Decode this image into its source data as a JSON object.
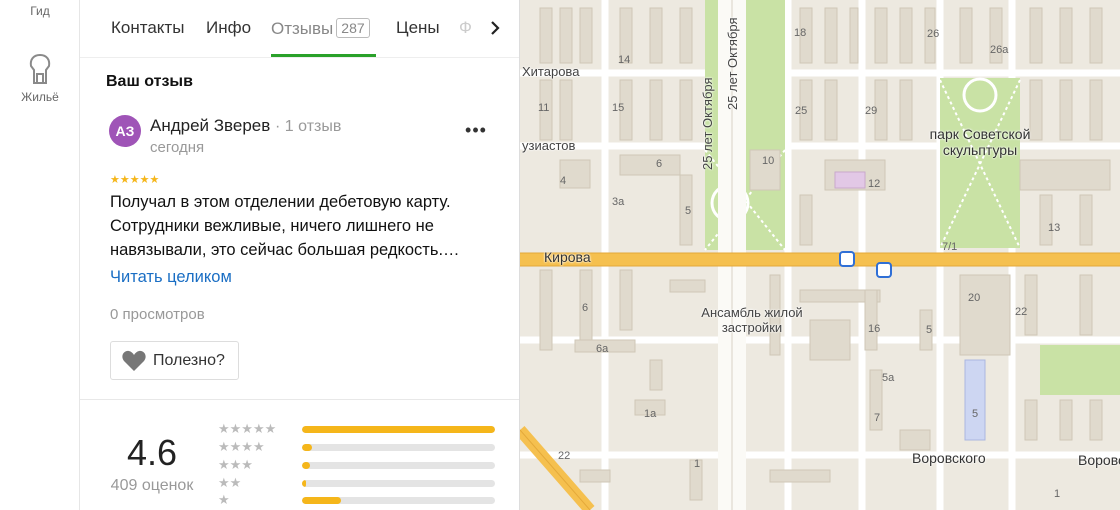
{
  "rail": {
    "top_label": "Гид",
    "housing_label": "Жильё"
  },
  "tabs": [
    {
      "label": "Контакты"
    },
    {
      "label": "Инфо"
    },
    {
      "label": "Отзывы",
      "count": "287"
    },
    {
      "label": "Цены"
    }
  ],
  "tab_faded": "Ф",
  "section_title": "Ваш отзыв",
  "review": {
    "avatar_initials": "АЗ",
    "author": "Андрей Зверев",
    "author_reviews": "1 отзыв",
    "date": "сегодня",
    "stars": "★★★★★",
    "text": "Получал в этом отделении дебетовую карту. Сотрудники вежливые, ничего лишнего не навязывали, это сейчас большая редкость.…",
    "read_more": "Читать целиком",
    "views": "0 просмотров",
    "useful_label": "Полезно?"
  },
  "rating": {
    "value": "4.6",
    "count": "409 оценок",
    "distribution": [
      {
        "stars": "★★★★★",
        "fraction": 1.0
      },
      {
        "stars": "★★★★",
        "fraction": 0.05
      },
      {
        "stars": "★★★",
        "fraction": 0.04
      },
      {
        "stars": "★★",
        "fraction": 0.02
      },
      {
        "stars": "★",
        "fraction": 0.2
      }
    ]
  },
  "map": {
    "streets": [
      "Хитарова",
      "узиастов",
      "Кирова",
      "Воровского",
      "Воровс"
    ],
    "vertical_streets": [
      "25 лет Октября",
      "25 лет Октября"
    ],
    "park": "парк Советской скульптуры",
    "landmark": "Ансамбль жилой застройки",
    "house_numbers": [
      "14",
      "18",
      "26",
      "26а",
      "11",
      "15",
      "25",
      "29",
      "6",
      "10",
      "12",
      "4",
      "3а",
      "5",
      "13",
      "7/1",
      "6",
      "20",
      "22",
      "16",
      "5",
      "5а",
      "6а",
      "7",
      "1а",
      "22",
      "1",
      "5",
      "1"
    ],
    "colors": {
      "road_main": "#f5c04f",
      "park": "#c9e2a5",
      "building": "#e0dacd",
      "accent_green": "#2aa12a",
      "accent_star": "#f5b61a",
      "link": "#1a6ec4",
      "avatar_bg": "#9f54b7"
    }
  }
}
